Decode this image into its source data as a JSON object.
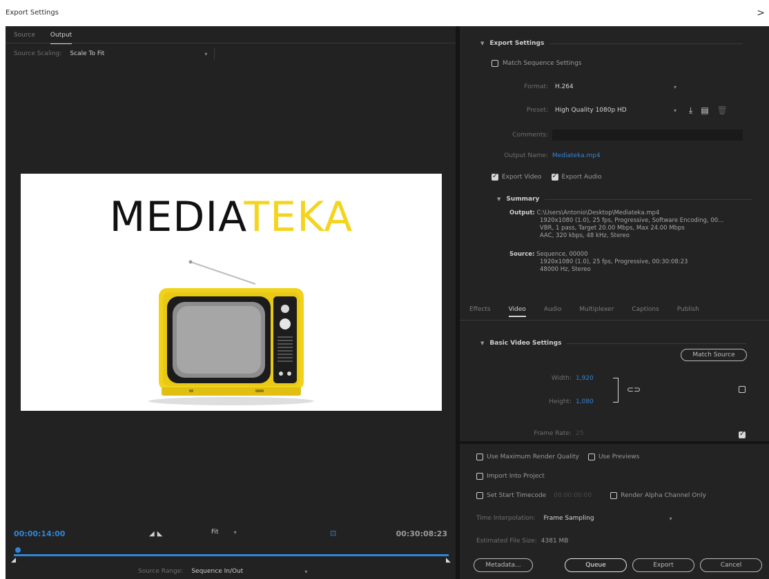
{
  "window": {
    "title": "Export Settings",
    "close_glyph": ">"
  },
  "source_tabs": {
    "source": "Source",
    "output": "Output"
  },
  "source_scaling": {
    "label": "Source Scaling:",
    "value": "Scale To Fit"
  },
  "preview": {
    "logo_part1": "MEDIA",
    "logo_part2": "TEKA"
  },
  "timeline": {
    "current_time": "00:00:14:00",
    "end_time": "00:30:08:23",
    "zoom_value": "Fit",
    "source_range_label": "Source Range:",
    "source_range_value": "Sequence In/Out"
  },
  "export_settings": {
    "section_title": "Export Settings",
    "match_sequence_label": "Match Sequence Settings",
    "format_label": "Format:",
    "format_value": "H.264",
    "preset_label": "Preset:",
    "preset_value": "High Quality 1080p HD",
    "comments_label": "Comments:",
    "comments_value": "",
    "output_name_label": "Output Name:",
    "output_name_value": "Mediateka.mp4",
    "export_video_label": "Export Video",
    "export_audio_label": "Export Audio"
  },
  "summary": {
    "title": "Summary",
    "output_key": "Output:",
    "output_lines": [
      "C:\\Users\\Antonio\\Desktop\\Mediateka.mp4",
      "1920x1080 (1.0), 25 fps, Progressive, Software Encoding, 00...",
      "VBR, 1 pass, Target 20.00 Mbps, Max 24.00 Mbps",
      "AAC, 320 kbps, 48 kHz, Stereo"
    ],
    "source_key": "Source:",
    "source_lines": [
      "Sequence, 00000",
      "1920x1080 (1.0), 25 fps, Progressive, 00:30:08:23",
      "48000 Hz, Stereo"
    ]
  },
  "settings_tabs": [
    "Effects",
    "Video",
    "Audio",
    "Multiplexer",
    "Captions",
    "Publish"
  ],
  "video": {
    "section_title": "Basic Video Settings",
    "match_source": "Match Source",
    "width_label": "Width:",
    "width_value": "1,920",
    "height_label": "Height:",
    "height_value": "1,080",
    "frame_rate_label": "Frame Rate:",
    "frame_rate_value": "25"
  },
  "bottom": {
    "max_render_quality": "Use Maximum Render Quality",
    "use_previews": "Use Previews",
    "import_into_project": "Import Into Project",
    "set_start_timecode": "Set Start Timecode",
    "start_timecode_value": "00:00:00:00",
    "render_alpha": "Render Alpha Channel Only",
    "time_interpolation_label": "Time Interpolation:",
    "time_interpolation_value": "Frame Sampling",
    "file_size_label": "Estimated File Size:",
    "file_size_value": "4381 MB",
    "metadata_button": "Metadata...",
    "queue_button": "Queue",
    "export_button": "Export",
    "cancel_button": "Cancel"
  },
  "colors": {
    "accent_blue": "#2f86d8",
    "logo_yellow": "#f4d41f",
    "tv_yellow": "#f1d21b"
  }
}
